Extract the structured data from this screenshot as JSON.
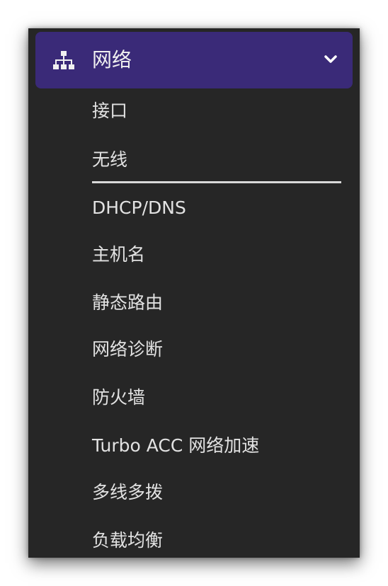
{
  "menu": {
    "header": {
      "title": "网络",
      "icon": "network-icon",
      "toggle_icon": "chevron-down-icon"
    },
    "active_item": "无线",
    "items": [
      {
        "label": "接口"
      },
      {
        "label": "无线"
      },
      {
        "label": "DHCP/DNS"
      },
      {
        "label": "主机名"
      },
      {
        "label": "静态路由"
      },
      {
        "label": "网络诊断"
      },
      {
        "label": "防火墙"
      },
      {
        "label": "Turbo ACC 网络加速"
      },
      {
        "label": "多线多拨"
      },
      {
        "label": "负载均衡"
      }
    ]
  },
  "colors": {
    "header_bg": "#3a2a78",
    "panel_bg": "#262626",
    "text": "#e2e2e2",
    "active_underline": "#d8d8d8"
  }
}
